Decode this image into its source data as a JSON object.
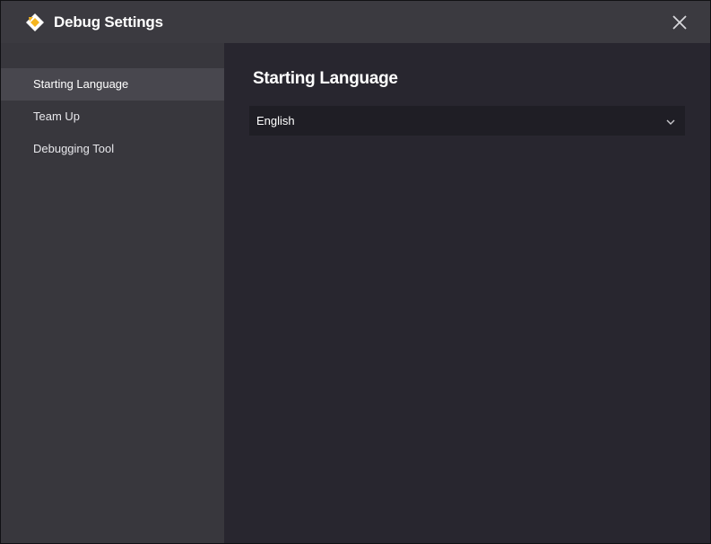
{
  "window": {
    "title": "Debug Settings",
    "icons": {
      "logo": "game-logo-icon",
      "close": "close-icon"
    },
    "colors": {
      "titlebar": "#3b3a40",
      "sidebar": "#38373d",
      "sidebar_active": "#48474e",
      "content": "#28262f",
      "select_bg": "#1f1e25",
      "logo_yellow": "#f5b520"
    }
  },
  "sidebar": {
    "items": [
      {
        "label": "Starting Language",
        "active": true
      },
      {
        "label": "Team Up",
        "active": false
      },
      {
        "label": "Debugging Tool",
        "active": false
      }
    ]
  },
  "main": {
    "section_title": "Starting Language",
    "language_select": {
      "value": "English",
      "icon": "chevron-down-icon"
    }
  }
}
